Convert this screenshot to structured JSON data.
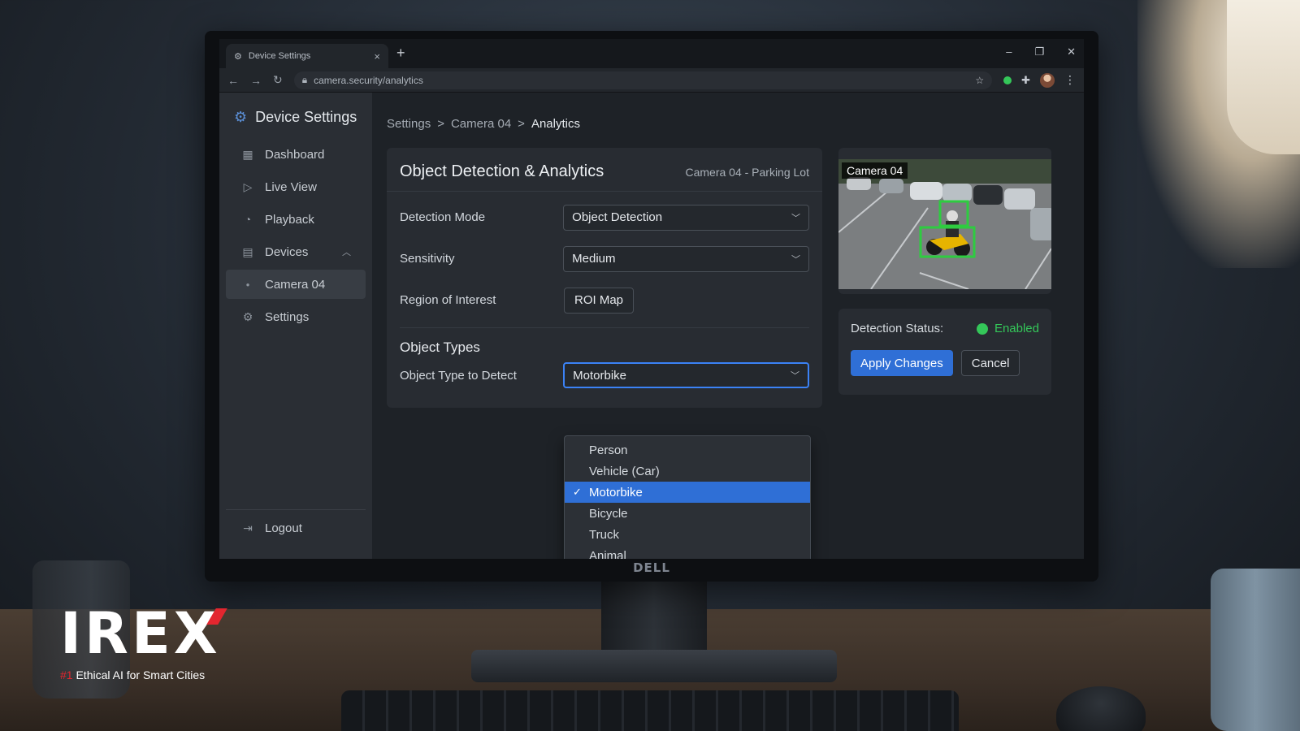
{
  "browser": {
    "tab_title": "Device Settings",
    "url": "camera.security/analytics",
    "new_tab": "+",
    "close_tab": "×"
  },
  "sidebar": {
    "title": "Device Settings",
    "items": [
      {
        "label": "Dashboard",
        "icon": "dashboard-icon"
      },
      {
        "label": "Live View",
        "icon": "play-icon"
      },
      {
        "label": "Playback",
        "icon": "history-icon"
      },
      {
        "label": "Devices",
        "icon": "devices-icon"
      },
      {
        "label": "Camera 04",
        "icon": "dot-icon"
      },
      {
        "label": "Settings",
        "icon": "gear-icon"
      }
    ],
    "logout": "Logout"
  },
  "breadcrumb": {
    "items": [
      "Settings",
      "Camera 04",
      "Analytics"
    ],
    "separator": ">"
  },
  "card": {
    "title": "Object Detection & Analytics",
    "subtitle": "Camera 04 - Parking Lot",
    "detection_mode_label": "Detection Mode",
    "detection_mode_value": "Object Detection",
    "sensitivity_label": "Sensitivity",
    "sensitivity_value": "Medium",
    "roi_label": "Region of Interest",
    "roi_button": "ROI Map",
    "object_types_title": "Object Types",
    "object_type_label": "Object Type to Detect",
    "object_type_value": "Motorbike"
  },
  "dropdown": {
    "options": [
      "Person",
      "Vehicle (Car)",
      "Motorbike",
      "Bicycle",
      "Truck",
      "Animal"
    ],
    "selected": "Motorbike"
  },
  "preview": {
    "label": "Camera 04"
  },
  "status": {
    "label": "Detection Status:",
    "value": "Enabled",
    "apply_button": "Apply Changes",
    "cancel_button": "Cancel"
  },
  "monitor_brand": "DELL",
  "branding": {
    "logo": "IREX",
    "tag_number": "#1",
    "tag_text": " Ethical AI for Smart Cities"
  },
  "colors": {
    "accent": "#2f6fd6",
    "enabled": "#34c759",
    "brand_red": "#e3262f"
  }
}
